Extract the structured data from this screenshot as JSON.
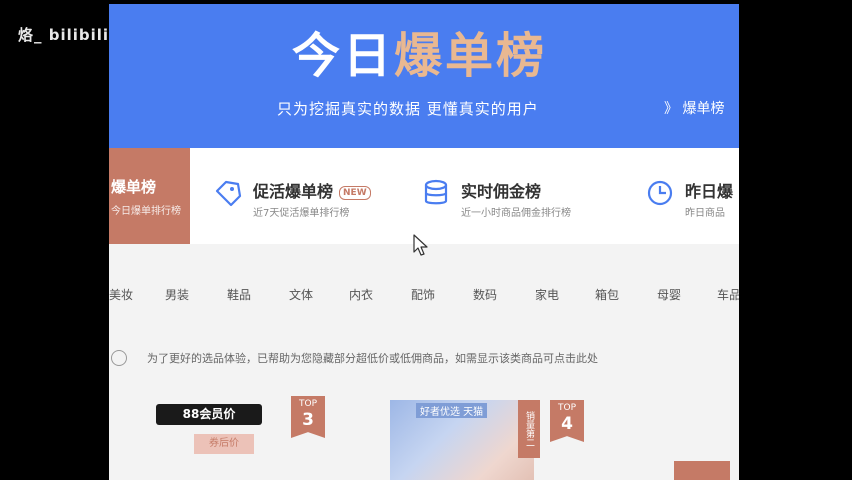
{
  "watermark": "烙_ bilibili",
  "hero": {
    "title_prefix": "今日",
    "title_highlight": "爆单榜",
    "subtitle": "只为挖掘真实的数据 更懂真实的用户",
    "side_text": "》 爆单榜"
  },
  "boards": [
    {
      "label": "爆单榜",
      "desc": "今日爆单排行榜",
      "active": true
    },
    {
      "label": "促活爆单榜",
      "desc": "近7天促活爆单排行榜",
      "badge": "NEW",
      "icon": "tag-icon"
    },
    {
      "label": "实时佣金榜",
      "desc": "近一小时商品佣金排行榜",
      "icon": "database-icon"
    },
    {
      "label": "昨日爆",
      "desc": "昨日商品",
      "icon": "clock-icon"
    }
  ],
  "categories": [
    "美妆",
    "男装",
    "鞋品",
    "文体",
    "内衣",
    "配饰",
    "数码",
    "家电",
    "箱包",
    "母婴",
    "车品"
  ],
  "notice": "为了更好的选品体验，已帮助为您隐藏部分超低价或低佣商品，如需显示该类商品可点击此处",
  "products": {
    "tag_88": "88会员价",
    "pink_label": "券后价",
    "top3": {
      "a": "TOP",
      "b": "3"
    },
    "top4": {
      "a": "TOP",
      "b": "4"
    },
    "img_caption": "好者优选 天猫",
    "img_tag": "销量第二"
  },
  "colors": {
    "hero": "#4a7df0",
    "accent": "#c57a66",
    "highlight": "#e9b891"
  }
}
